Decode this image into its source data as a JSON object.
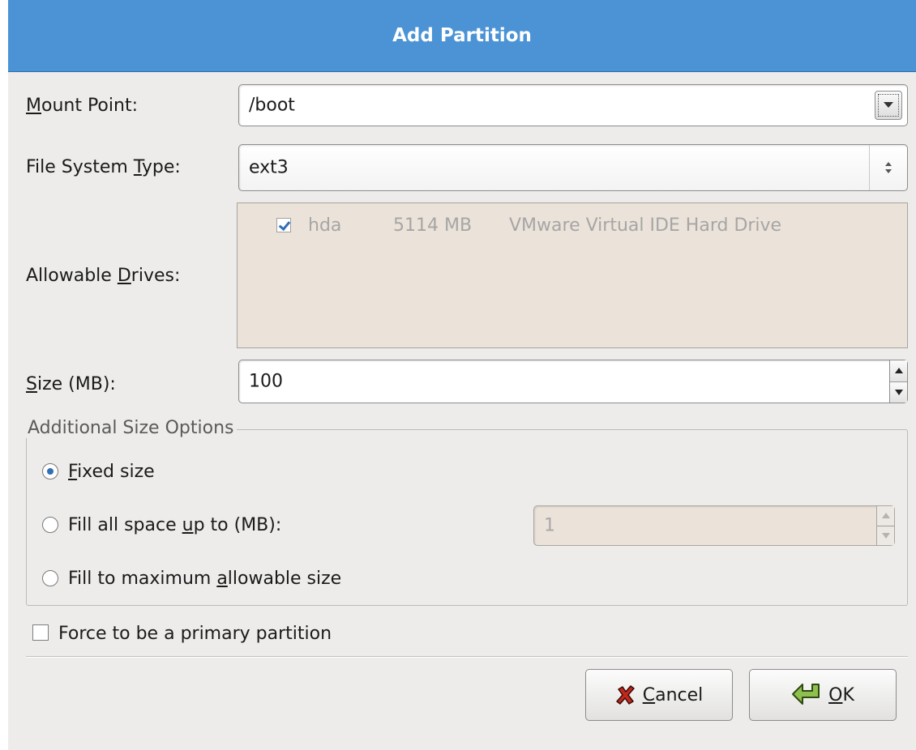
{
  "dialog": {
    "title": "Add Partition"
  },
  "mount_point": {
    "label_prefix": "",
    "label_mnemonic": "M",
    "label_rest": "ount Point:",
    "value": "/boot"
  },
  "fs_type": {
    "label_prefix": "File System ",
    "label_mnemonic": "T",
    "label_rest": "ype:",
    "value": "ext3"
  },
  "drives": {
    "label_prefix": "Allowable ",
    "label_mnemonic": "D",
    "label_rest": "rives:",
    "rows": [
      {
        "checked": true,
        "name": "hda",
        "size": "5114 MB",
        "model": "VMware Virtual IDE Hard Drive"
      }
    ]
  },
  "size": {
    "label_prefix": "",
    "label_mnemonic": "S",
    "label_rest": "ize (MB):",
    "value": "100"
  },
  "size_options": {
    "legend": "Additional Size Options",
    "fixed": {
      "prefix": "",
      "mnemonic": "F",
      "rest": "ixed size",
      "selected": true
    },
    "fill_upto": {
      "prefix": "Fill all space ",
      "mnemonic": "u",
      "rest": "p to (MB):",
      "selected": false,
      "value": "1"
    },
    "fill_max": {
      "prefix": "Fill to maximum ",
      "mnemonic": "a",
      "rest": "llowable size",
      "selected": false
    }
  },
  "force_primary": {
    "label": "Force to be a primary partition",
    "checked": false
  },
  "buttons": {
    "cancel": {
      "mnemonic": "C",
      "rest": "ancel"
    },
    "ok": {
      "mnemonic": "O",
      "rest": "K"
    }
  },
  "colors": {
    "title_bar": "#4b93d5",
    "dialog_bg": "#edeceb",
    "drives_bg": "#ebe2d9",
    "accent": "#2f6fb5"
  },
  "icons": {
    "cancel": "x-cancel-icon",
    "ok": "ok-arrow-icon"
  }
}
